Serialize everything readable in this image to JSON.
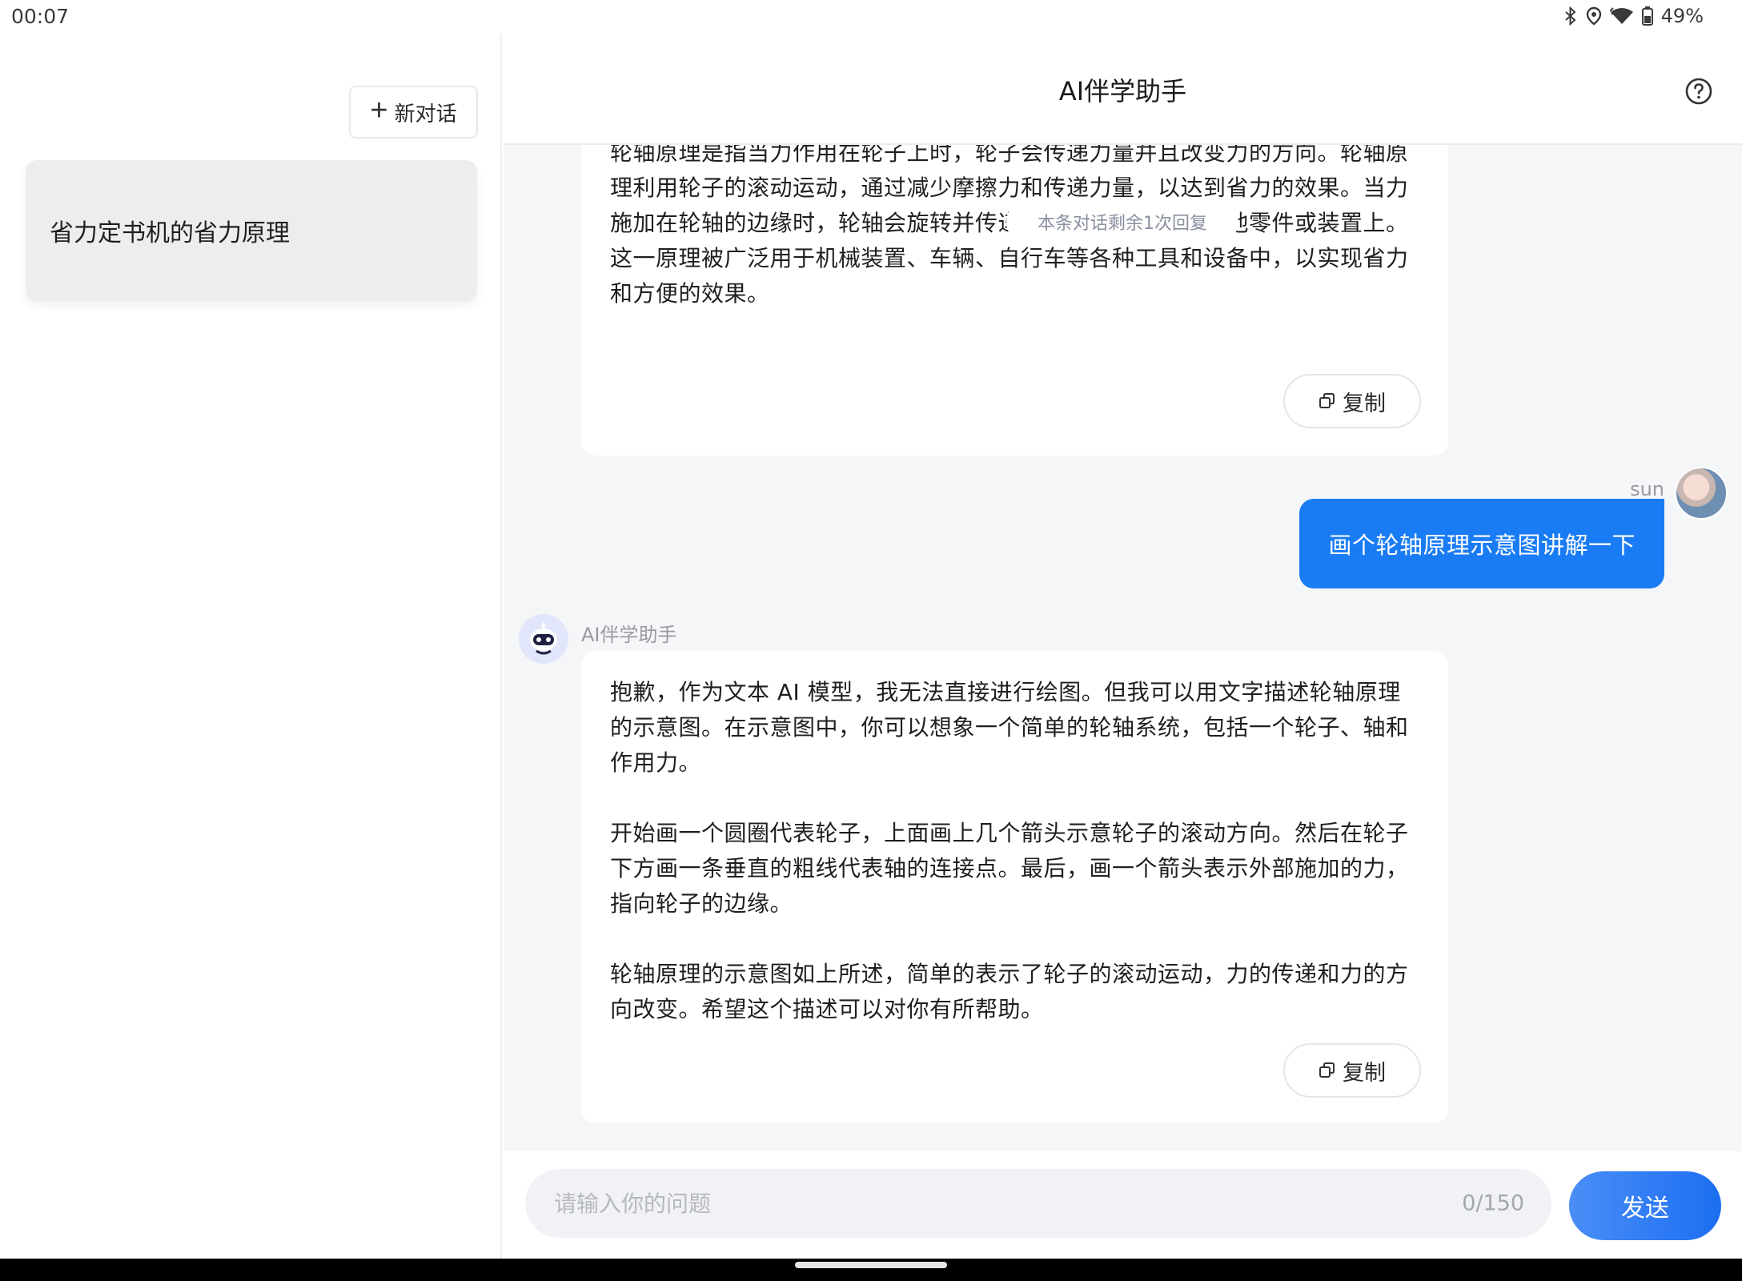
{
  "status": {
    "time": "00:07",
    "battery": "49%"
  },
  "sidebar": {
    "new_chat_label": "新对话",
    "conversations": [
      {
        "title": "省力定书机的省力原理"
      }
    ]
  },
  "header": {
    "title": "AI伴学助手"
  },
  "chat": {
    "toast": "本条对话剩余1次回复",
    "messages": [
      {
        "role": "assistant",
        "paragraphs": [
          "轮轴原理是指当力作用在轮子上时，轮子会传递力量并且改变力的方向。轮轴原理利用轮子的滚动运动，通过减少摩擦力和传递力量，以达到省力的效果。当力施加在轮轴的边缘时，轮轴会旋转并传递力量到与之相连的其他零件或装置上。这一原理被广泛用于机械装置、车辆、自行车等各种工具和设备中，以实现省力和方便的效果。"
        ],
        "copy_label": "复制"
      },
      {
        "role": "user",
        "name": "sun",
        "text": "画个轮轴原理示意图讲解一下"
      },
      {
        "role": "assistant",
        "name": "AI伴学助手",
        "paragraphs": [
          "抱歉，作为文本 AI 模型，我无法直接进行绘图。但我可以用文字描述轮轴原理的示意图。在示意图中，你可以想象一个简单的轮轴系统，包括一个轮子、轴和作用力。",
          "开始画一个圆圈代表轮子，上面画上几个箭头示意轮子的滚动方向。然后在轮子下方画一条垂直的粗线代表轴的连接点。最后，画一个箭头表示外部施加的力，指向轮子的边缘。",
          "轮轴原理的示意图如上所述，简单的表示了轮子的滚动运动，力的传递和力的方向改变。希望这个描述可以对你有所帮助。"
        ],
        "copy_label": "复制"
      }
    ]
  },
  "input": {
    "placeholder": "请输入你的问题",
    "char_count": "0/150",
    "send_label": "发送"
  },
  "colors": {
    "accent": "#1a7cf5",
    "background": "#f5f6f8"
  }
}
